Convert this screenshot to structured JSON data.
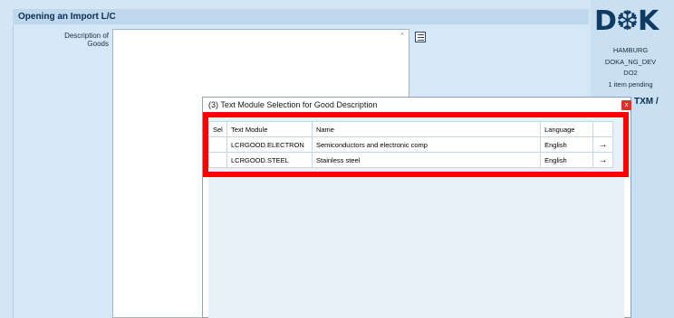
{
  "page": {
    "title": "Opening an Import L/C"
  },
  "form": {
    "description_label": "Description of Goods",
    "description_value": ""
  },
  "side_panel": {
    "logo_text": "D❆K",
    "location": "HAMBURG",
    "environment": "DOKA_NG_DEV",
    "instance": "DO2",
    "pending": "1 item pending",
    "section_label": "TXM /"
  },
  "dialog": {
    "title": "(3) Text Module Selection for Good Description",
    "close_label": "x",
    "columns": [
      "Sel",
      "Text Module",
      "Name",
      "Language",
      ""
    ],
    "rows": [
      {
        "sel": "",
        "module": "LCRGOOD.ELECTRON",
        "name": "Semiconductors and electronic comp",
        "language": "English",
        "action": "→"
      },
      {
        "sel": "",
        "module": "LCRGOOD.STEEL",
        "name": "Stainless steel",
        "language": "English",
        "action": "→"
      }
    ]
  },
  "colors": {
    "highlight": "#ff0000",
    "background": "#d4e6f5",
    "title_text": "#0b2d52",
    "close_button": "#d9342b"
  }
}
